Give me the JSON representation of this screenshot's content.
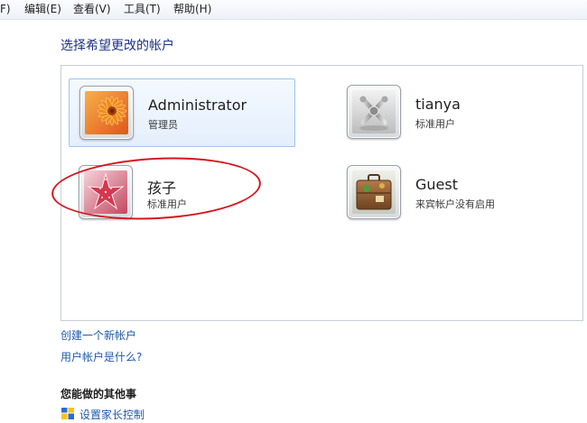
{
  "menu": [
    "F)",
    "编辑(E)",
    "查看(V)",
    "工具(T)",
    "帮助(H)"
  ],
  "page_title": "选择希望更改的帐户",
  "accounts": [
    {
      "name": "Administrator",
      "role": "管理员",
      "picture": "orange-flower-picture"
    },
    {
      "name": "tianya",
      "role": "标准用户",
      "picture": "chess-pieces-picture"
    },
    {
      "name": "孩子",
      "role": "标准用户",
      "picture": "pink-starfish-picture"
    },
    {
      "name": "Guest",
      "role": "来宾帐户没有启用",
      "picture": "suitcase-picture"
    }
  ],
  "links": {
    "create_account": "创建一个新帐户",
    "what_is_account": "用户帐户是什么?"
  },
  "other_tasks": {
    "heading": "您能做的其他事",
    "first_task": "设置家长控制"
  },
  "colors": {
    "link": "#1e5aa8",
    "title": "#1e3287",
    "selection_border": "#9ec4eb",
    "annotation_ring": "#d8161c"
  }
}
